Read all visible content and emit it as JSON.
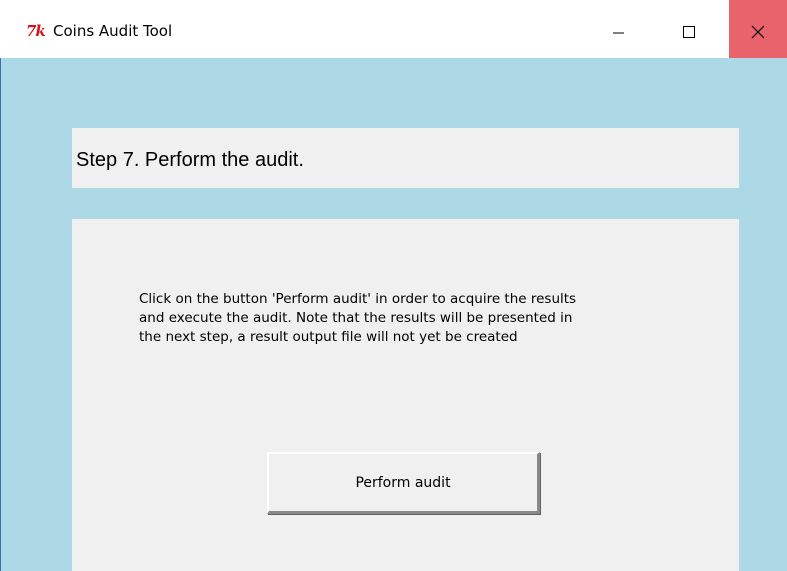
{
  "window": {
    "title": "Coins Audit Tool",
    "icon": "tk-icon",
    "icon_text": "7k",
    "controls": {
      "minimize": "minimize-icon",
      "maximize": "maximize-icon",
      "close": "close-icon"
    }
  },
  "step": {
    "title": "Step 7. Perform the audit."
  },
  "content": {
    "instructions": "Click on the button 'Perform audit' in order to acquire the results\nand execute the audit. Note that the results will be presented in\nthe next step, a result output file will not yet be created",
    "button_label": "Perform audit"
  },
  "colors": {
    "background": "#add8e6",
    "panel": "#f0f0f0",
    "close_hover": "#e8636c",
    "icon_red": "#d4141b"
  }
}
